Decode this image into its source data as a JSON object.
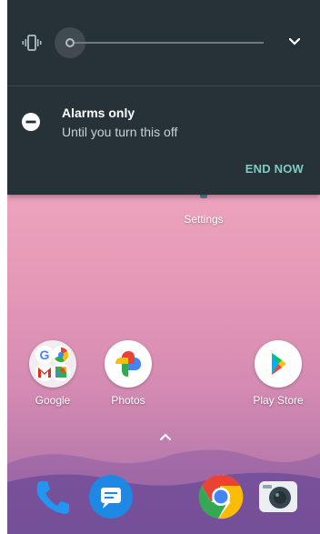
{
  "volume_panel": {
    "ringer_mode_icon": "vibrate-icon",
    "expand_icon": "chevron-down-icon",
    "volume_level": 0
  },
  "dnd": {
    "icon": "do-not-disturb-icon",
    "title": "Alarms only",
    "subtitle": "Until you turn this off",
    "end_button": "END NOW"
  },
  "home": {
    "settings_label": "Settings",
    "apps": [
      {
        "label": "Google",
        "icon": "google-folder-icon"
      },
      {
        "label": "Photos",
        "icon": "photos-icon"
      },
      {
        "label": "Play Store",
        "icon": "play-store-icon"
      }
    ],
    "app_drawer_icon": "chevron-up-icon",
    "dock": [
      "phone-icon",
      "messages-icon",
      "chrome-icon",
      "camera-icon"
    ]
  },
  "colors": {
    "panel": "#263238",
    "accent": "#80cbc4"
  }
}
